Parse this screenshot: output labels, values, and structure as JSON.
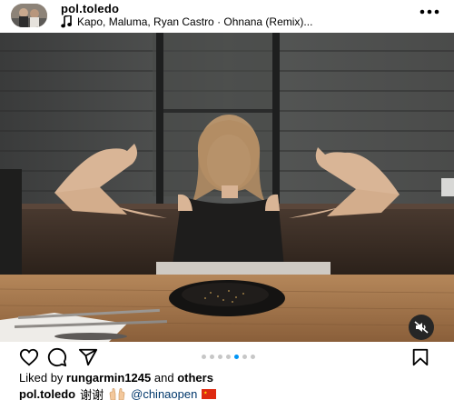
{
  "post": {
    "username": "pol.toledo",
    "audio": "Kapo, Maluma, Ryan Castro · Ohnana (Remix)..."
  },
  "carousel": {
    "count": 7,
    "active_index": 4
  },
  "likes": {
    "prefix": "Liked by",
    "user": "rungarmin1245",
    "conjunction": "and",
    "suffix": "others"
  },
  "caption": {
    "username": "pol.toledo",
    "text": "谢谢",
    "mention": "@chinaopen"
  },
  "icons": {
    "header": [
      "music-icon",
      "more-icon"
    ],
    "actions": [
      "heart-icon",
      "comment-icon",
      "share-icon",
      "bookmark-icon"
    ],
    "overlay": [
      "mute-icon"
    ],
    "caption": [
      "hands-icon",
      "china-flag-icon"
    ]
  },
  "colors": {
    "link": "#00376b",
    "active_dot": "#0095f6",
    "inactive_dot": "#c7c7c7"
  }
}
